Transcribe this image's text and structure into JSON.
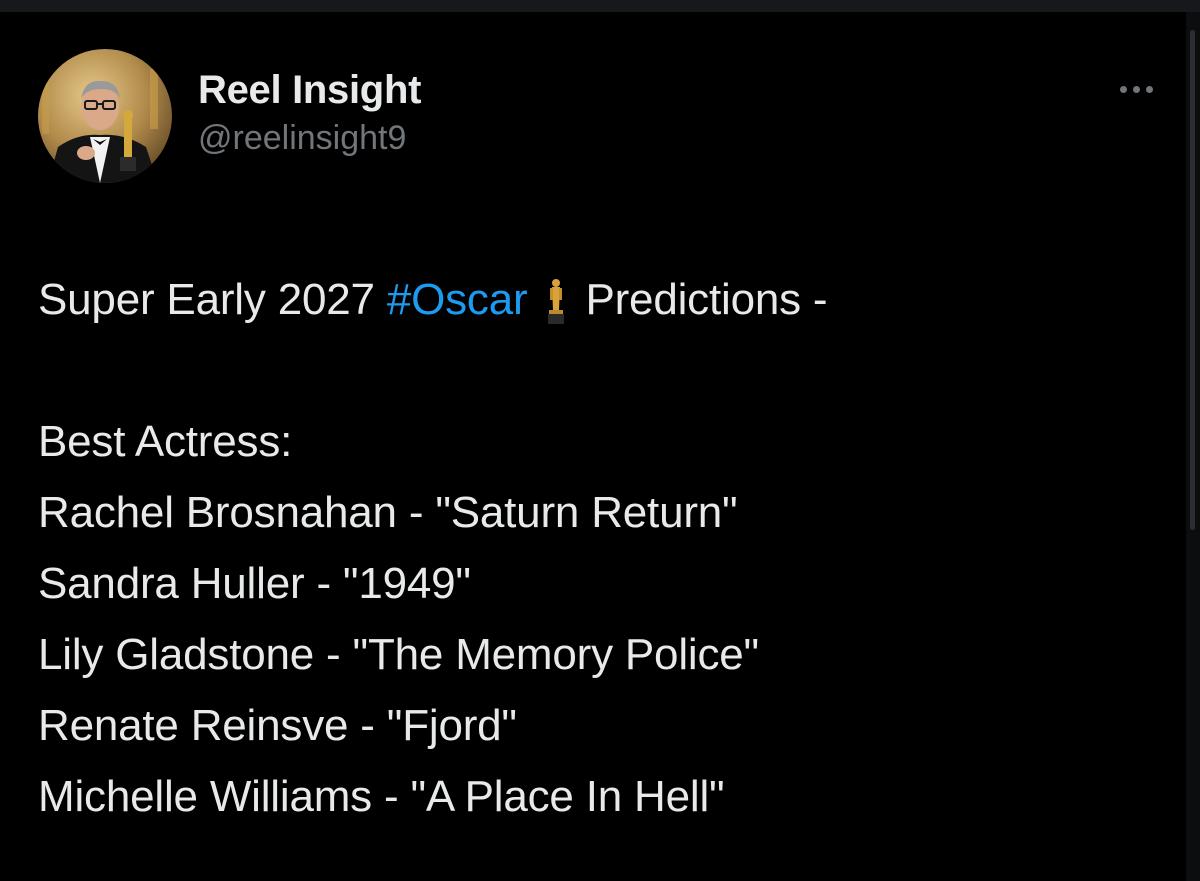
{
  "tweet": {
    "author": {
      "display_name": "Reel Insight",
      "handle": "@reelinsight9",
      "avatar_icon": "profile-photo-man-holding-oscar"
    },
    "more_icon": "ellipsis-icon",
    "text": {
      "intro_before": "Super Early 2027",
      "hashtag": "#Oscar",
      "emoji": "oscar-trophy-emoji",
      "intro_after": "Predictions -",
      "category": "Best Actress:",
      "nominees": [
        "Rachel Brosnahan - \"Saturn Return\"",
        "Sandra Huller - \"1949\"",
        "Lily Gladstone - \"The Memory Police\"",
        "Renate Reinsve - \"Fjord\"",
        "Michelle Williams - \"A Place In Hell\""
      ]
    }
  },
  "colors": {
    "background": "#000000",
    "primary_text": "#e7e9ea",
    "secondary_text": "#71767b",
    "link": "#1d9bf0"
  }
}
